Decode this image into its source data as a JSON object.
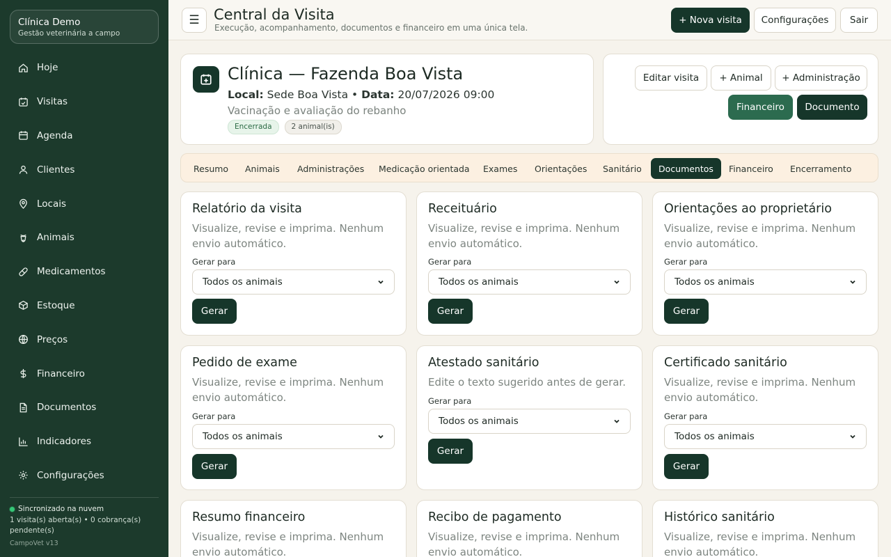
{
  "app": {
    "clinic_name": "Clínica Demo",
    "clinic_sub": "Gestão veterinária a campo",
    "sync_status": "Sincronizado na nuvem",
    "sync_detail": "1 visita(s) aberta(s) • 0 cobrança(s) pendente(s)",
    "version": "CampoVet v13"
  },
  "sidebar": {
    "items": [
      {
        "label": "Hoje",
        "icon": "home-icon"
      },
      {
        "label": "Visitas",
        "icon": "calendar-check-icon"
      },
      {
        "label": "Agenda",
        "icon": "calendar-icon"
      },
      {
        "label": "Clientes",
        "icon": "user-icon"
      },
      {
        "label": "Locais",
        "icon": "map-pin-icon"
      },
      {
        "label": "Animais",
        "icon": "animal-icon"
      },
      {
        "label": "Medicamentos",
        "icon": "pill-icon"
      },
      {
        "label": "Estoque",
        "icon": "box-icon"
      },
      {
        "label": "Preços",
        "icon": "globe-icon"
      },
      {
        "label": "Financeiro",
        "icon": "dollar-icon"
      },
      {
        "label": "Documentos",
        "icon": "document-icon"
      },
      {
        "label": "Indicadores",
        "icon": "bar-chart-icon"
      },
      {
        "label": "Configurações",
        "icon": "gear-icon"
      }
    ]
  },
  "header": {
    "menu_icon": "☰",
    "title": "Central da Visita",
    "subtitle": "Execução, acompanhamento, documentos e financeiro em uma única tela.",
    "new_visit": "+ Nova visita",
    "settings": "Configurações",
    "logout": "Sair"
  },
  "visit": {
    "title": "Clínica — Fazenda Boa Vista",
    "local_label": "Local:",
    "local_value": "Sede Boa Vista",
    "separator": "•",
    "date_label": "Data:",
    "date_value": "20/07/2026 09:00",
    "description": "Vacinação e avaliação do rebanho",
    "status_badge": "Encerrada",
    "animals_badge": "2 animal(is)"
  },
  "actions": {
    "edit": "Editar visita",
    "add_animal": "+ Animal",
    "add_admin": "+ Administração",
    "financial": "Financeiro",
    "document": "Documento"
  },
  "tabs": [
    {
      "label": "Resumo",
      "active": false
    },
    {
      "label": "Animais",
      "active": false
    },
    {
      "label": "Administrações",
      "active": false
    },
    {
      "label": "Medicação orientada",
      "active": false
    },
    {
      "label": "Exames",
      "active": false
    },
    {
      "label": "Orientações",
      "active": false
    },
    {
      "label": "Sanitário",
      "active": false
    },
    {
      "label": "Documentos",
      "active": true
    },
    {
      "label": "Financeiro",
      "active": false
    },
    {
      "label": "Encerramento",
      "active": false
    }
  ],
  "documents": [
    {
      "title": "Relatório da visita",
      "desc": "Visualize, revise e imprima. Nenhum envio automático.",
      "field_label": "Gerar para",
      "select_value": "Todos os animais",
      "button": "Gerar"
    },
    {
      "title": "Receituário",
      "desc": "Visualize, revise e imprima. Nenhum envio automático.",
      "field_label": "Gerar para",
      "select_value": "Todos os animais",
      "button": "Gerar"
    },
    {
      "title": "Orientações ao proprietário",
      "desc": "Visualize, revise e imprima. Nenhum envio automático.",
      "field_label": "Gerar para",
      "select_value": "Todos os animais",
      "button": "Gerar"
    },
    {
      "title": "Pedido de exame",
      "desc": "Visualize, revise e imprima. Nenhum envio automático.",
      "field_label": "Gerar para",
      "select_value": "Todos os animais",
      "button": "Gerar"
    },
    {
      "title": "Atestado sanitário",
      "desc": "Edite o texto sugerido antes de gerar.",
      "field_label": "Gerar para",
      "select_value": "Todos os animais",
      "button": "Gerar"
    },
    {
      "title": "Certificado sanitário",
      "desc": "Visualize, revise e imprima. Nenhum envio automático.",
      "field_label": "Gerar para",
      "select_value": "Todos os animais",
      "button": "Gerar"
    },
    {
      "title": "Resumo financeiro",
      "desc": "Visualize, revise e imprima. Nenhum envio automático."
    },
    {
      "title": "Recibo de pagamento",
      "desc": "Visualize, revise e imprima. Nenhum envio automático."
    },
    {
      "title": "Histórico sanitário",
      "desc": "Visualize, revise e imprima. Nenhum envio automático."
    }
  ],
  "colors": {
    "sidebar_bg": "#1c3a2c",
    "primary": "#16362a",
    "accent": "#2c6b4f",
    "tab_bar_bg": "#fcf0e1",
    "sync_dot": "#35c777"
  }
}
